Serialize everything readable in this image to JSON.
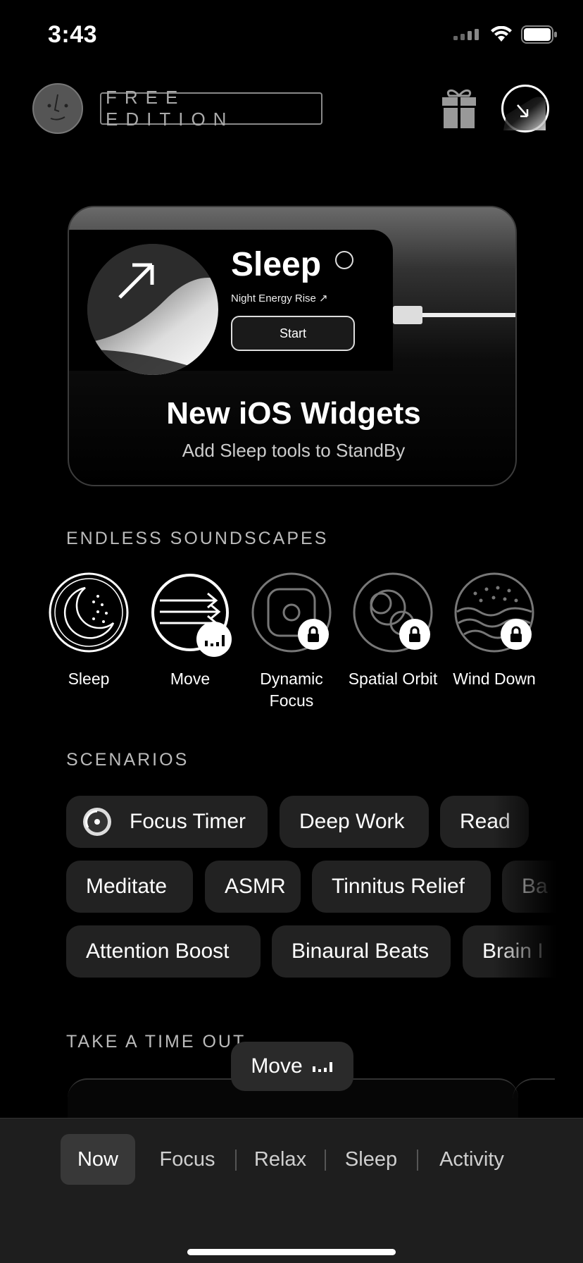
{
  "status_bar": {
    "time": "3:43"
  },
  "header": {
    "edition_label": "FREE EDITION"
  },
  "promo": {
    "widget_title": "Sleep",
    "widget_subtitle": "Night Energy Rise ↗",
    "widget_button": "Start",
    "title": "New iOS Widgets",
    "subtitle": "Add Sleep tools to StandBy"
  },
  "soundscapes": {
    "title": "ENDLESS SOUNDSCAPES",
    "items": [
      {
        "label": "Sleep",
        "icon": "moon-stars-icon",
        "locked": false
      },
      {
        "label": "Move",
        "icon": "arrows-flow-icon",
        "locked": false,
        "playing": true
      },
      {
        "label": "Dynamic Focus",
        "icon": "dynamic-focus-icon",
        "locked": true
      },
      {
        "label": "Spatial Orbit",
        "icon": "orbit-icon",
        "locked": true
      },
      {
        "label": "Wind Down",
        "icon": "waves-icon",
        "locked": true
      }
    ]
  },
  "scenarios": {
    "title": "SCENARIOS",
    "rows": [
      [
        "Focus Timer",
        "Deep Work",
        "Read"
      ],
      [
        "Meditate",
        "ASMR",
        "Tinnitus Relief",
        "Ba"
      ],
      [
        "Attention Boost",
        "Binaural Beats",
        "Brain I"
      ]
    ]
  },
  "timeout": {
    "title": "TAKE A TIME OUT"
  },
  "now_playing": {
    "label": "Move"
  },
  "tabs": {
    "now": "Now",
    "focus": "Focus",
    "relax": "Relax",
    "sleep": "Sleep",
    "activity": "Activity"
  }
}
